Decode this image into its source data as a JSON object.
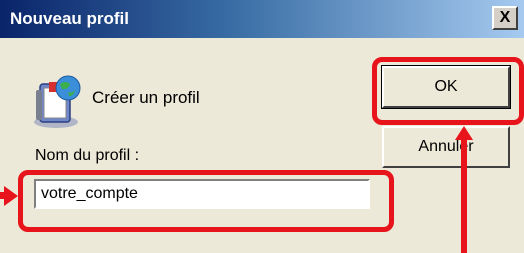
{
  "window": {
    "title": "Nouveau profil",
    "close_label": "X"
  },
  "header": {
    "create_label": "Créer un profil",
    "icon": "profile-folder-icon"
  },
  "form": {
    "name_label": "Nom du profil :",
    "name_value": "votre_compte"
  },
  "buttons": {
    "ok_label": "OK",
    "cancel_label": "Annuler"
  },
  "colors": {
    "highlight": "#e8141b",
    "titlebar_start": "#0a246a",
    "titlebar_end": "#a6caf0",
    "dialog_bg": "#ece9d8"
  }
}
